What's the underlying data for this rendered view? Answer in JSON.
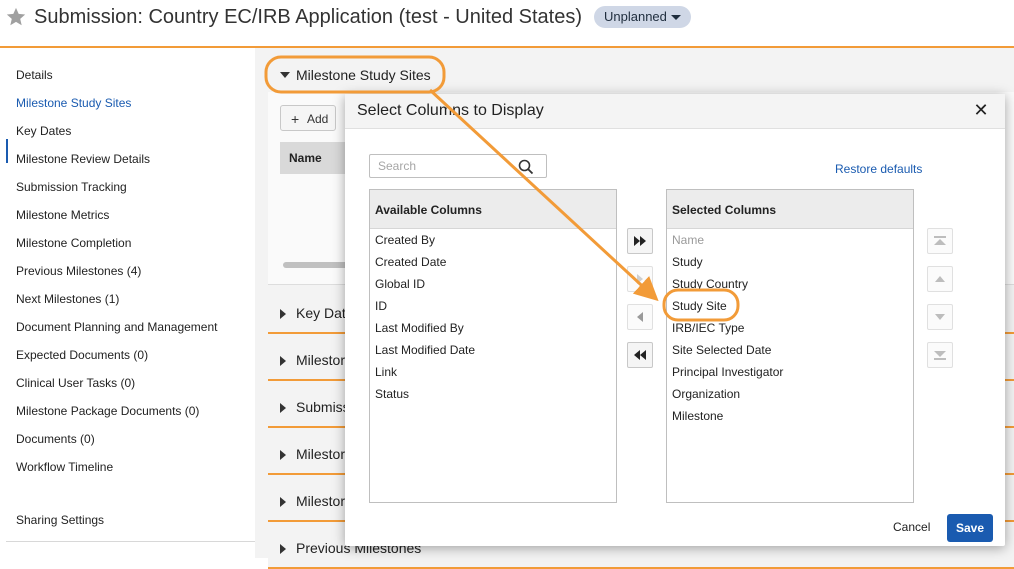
{
  "header": {
    "title": "Submission: Country EC/IRB Application (test - United States)",
    "status": "Unplanned"
  },
  "sidebar": {
    "items": [
      {
        "label": "Details"
      },
      {
        "label": "Milestone Study Sites"
      },
      {
        "label": "Key Dates"
      },
      {
        "label": "Milestone Review Details"
      },
      {
        "label": "Submission Tracking"
      },
      {
        "label": "Milestone Metrics"
      },
      {
        "label": "Milestone Completion"
      },
      {
        "label": "Previous Milestones (4)"
      },
      {
        "label": "Next Milestones (1)"
      },
      {
        "label": "Document Planning and Management"
      },
      {
        "label": "Expected Documents (0)"
      },
      {
        "label": "Clinical User Tasks (0)"
      },
      {
        "label": "Milestone Package Documents (0)"
      },
      {
        "label": "Documents (0)"
      },
      {
        "label": "Workflow Timeline"
      }
    ],
    "active_index": 1,
    "sharing": "Sharing Settings"
  },
  "sections": {
    "open_label": "Milestone Study Sites",
    "add_label": "Add",
    "grid_header": "Name",
    "collapsed": [
      "Key Dat",
      "Milestor",
      "Submiss",
      "Milestor",
      "Milestor",
      "Previous Milestones"
    ]
  },
  "modal": {
    "title": "Select Columns to Display",
    "search_placeholder": "Search",
    "restore_label": "Restore defaults",
    "available_header": "Available Columns",
    "available": [
      "Created By",
      "Created Date",
      "Global ID",
      "ID",
      "Last Modified By",
      "Last Modified Date",
      "Link",
      "Status"
    ],
    "selected_header": "Selected Columns",
    "selected": [
      "Name",
      "Study",
      "Study Country",
      "Study Site",
      "IRB/IEC Type",
      "Site Selected Date",
      "Principal Investigator",
      "Organization",
      "Milestone"
    ],
    "selected_disabled_index": 0,
    "highlighted_item": "Study Site",
    "cancel_label": "Cancel",
    "save_label": "Save"
  },
  "colors": {
    "accent_orange": "#f29b38",
    "link_blue": "#1a5bb0",
    "badge_bg": "#cfd7e6"
  },
  "icons": [
    "star-icon",
    "caret-down-icon",
    "search-icon",
    "close-icon",
    "move-all-right-icon",
    "move-right-icon",
    "move-left-icon",
    "move-all-left-icon",
    "move-top-icon",
    "move-up-icon",
    "move-down-icon",
    "move-bottom-icon"
  ]
}
